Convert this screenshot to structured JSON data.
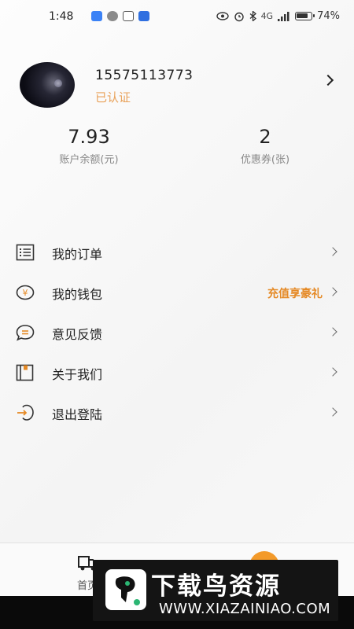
{
  "status_bar": {
    "time": "1:48",
    "network_label": "4G",
    "battery": "74%"
  },
  "profile": {
    "phone": "15575113773",
    "status": "已认证"
  },
  "stats": [
    {
      "value": "7.93",
      "label": "账户余额(元)"
    },
    {
      "value": "2",
      "label": "优惠券(张)"
    }
  ],
  "menu": [
    {
      "label": "我的订单",
      "icon": "order-list-icon"
    },
    {
      "label": "我的钱包",
      "icon": "wallet-yuan-icon",
      "promo": "充值享豪礼"
    },
    {
      "label": "意见反馈",
      "icon": "feedback-icon"
    },
    {
      "label": "关于我们",
      "icon": "about-book-icon"
    },
    {
      "label": "退出登陆",
      "icon": "logout-icon"
    }
  ],
  "bottom_nav": {
    "home_label": "首页"
  },
  "watermark": {
    "title": "下载鸟资源",
    "url": "WWW.XIAZAINIAO.COM"
  },
  "colors": {
    "accent_orange": "#e58a26",
    "verified_orange": "#e9a25a",
    "nav_orange": "#f39a2a"
  }
}
